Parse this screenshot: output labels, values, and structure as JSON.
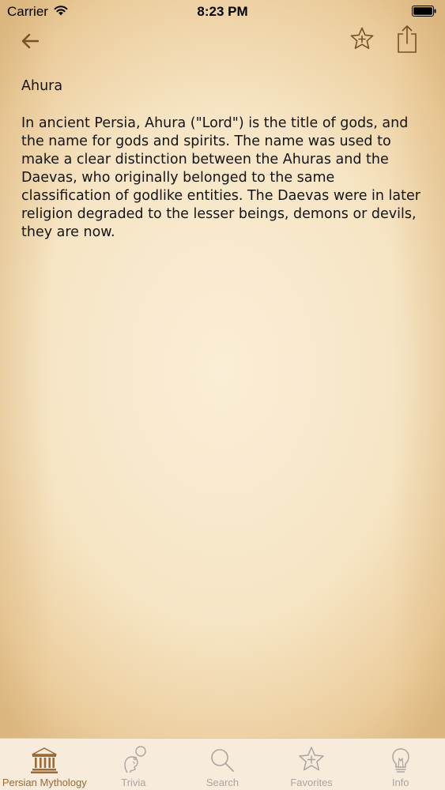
{
  "status_bar": {
    "carrier": "Carrier",
    "time": "8:23 PM",
    "wifi_icon": "wifi-icon",
    "battery_icon": "battery-icon"
  },
  "nav": {
    "back_icon": "arrow-left-icon",
    "favorite_icon": "star-add-icon",
    "share_icon": "share-icon"
  },
  "article": {
    "title": "Ahura",
    "body": "In ancient Persia, Ahura (\"Lord\") is the title of gods, and the name for gods and spirits. The name was used to make a clear distinction between the Ahuras and the Daevas, who originally belonged to the same classification of godlike entities. The Daevas were in later religion degraded to the lesser beings, demons or devils, they are now."
  },
  "tab_bar": {
    "tabs": [
      {
        "label": "Persian Mythology",
        "icon": "temple-icon",
        "active": true
      },
      {
        "label": "Trivia",
        "icon": "thinking-person-icon",
        "active": false
      },
      {
        "label": "Search",
        "icon": "search-icon",
        "active": false
      },
      {
        "label": "Favorites",
        "icon": "star-icon",
        "active": false
      },
      {
        "label": "Info",
        "icon": "lightbulb-icon",
        "active": false
      }
    ]
  },
  "colors": {
    "accent": "#9a6a37",
    "icon_brown": "#7a4f26",
    "inactive": "#a9a5a1",
    "text": "#141414"
  }
}
